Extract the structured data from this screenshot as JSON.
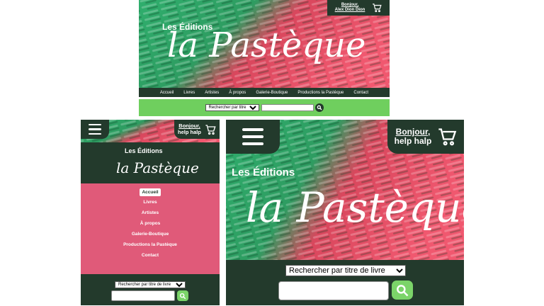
{
  "brand": {
    "kicker": "Les Éditions",
    "title": "la Pastèque"
  },
  "account": {
    "desktop_greeting": "Bonjour,",
    "desktop_user": "Alex Dion Dion",
    "mobile_greeting": "Bonjour,",
    "mobile_user": "help halp"
  },
  "nav": {
    "items": [
      {
        "label": "Accueil"
      },
      {
        "label": "Livres"
      },
      {
        "label": "Artistes"
      },
      {
        "label": "À propos"
      },
      {
        "label": "Galerie-Boutique"
      },
      {
        "label": "Productions la Pastèque"
      },
      {
        "label": "Contact"
      }
    ],
    "active": "Accueil"
  },
  "search": {
    "select_label": "Rechercher par titre de livre",
    "query": ""
  },
  "colors": {
    "dark_green": "#233a2c",
    "light_green": "#6fcf5e",
    "menu_pink": "#e05a79",
    "watermelon_red": "#e8485f",
    "watermelon_green": "#2fae6d"
  },
  "icons": [
    "cart-icon",
    "hamburger-icon",
    "search-icon"
  ]
}
